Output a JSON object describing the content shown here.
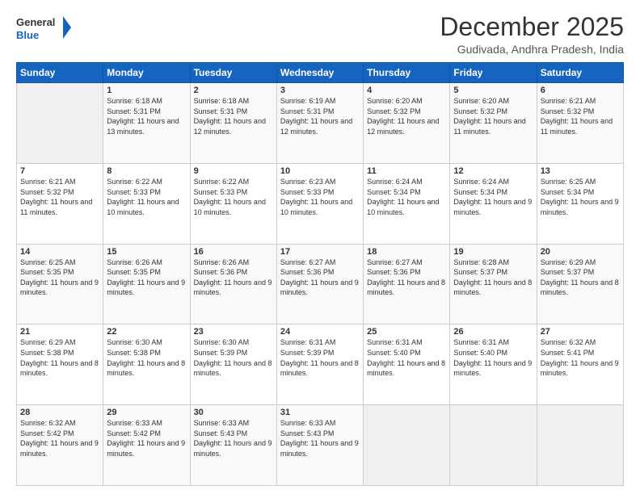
{
  "header": {
    "logo_general": "General",
    "logo_blue": "Blue",
    "month_title": "December 2025",
    "location": "Gudivada, Andhra Pradesh, India"
  },
  "days_of_week": [
    "Sunday",
    "Monday",
    "Tuesday",
    "Wednesday",
    "Thursday",
    "Friday",
    "Saturday"
  ],
  "weeks": [
    [
      {
        "day": "",
        "empty": true
      },
      {
        "day": "1",
        "sunrise": "6:18 AM",
        "sunset": "5:31 PM",
        "daylight": "11 hours and 13 minutes."
      },
      {
        "day": "2",
        "sunrise": "6:18 AM",
        "sunset": "5:31 PM",
        "daylight": "11 hours and 12 minutes."
      },
      {
        "day": "3",
        "sunrise": "6:19 AM",
        "sunset": "5:31 PM",
        "daylight": "11 hours and 12 minutes."
      },
      {
        "day": "4",
        "sunrise": "6:20 AM",
        "sunset": "5:32 PM",
        "daylight": "11 hours and 12 minutes."
      },
      {
        "day": "5",
        "sunrise": "6:20 AM",
        "sunset": "5:32 PM",
        "daylight": "11 hours and 11 minutes."
      },
      {
        "day": "6",
        "sunrise": "6:21 AM",
        "sunset": "5:32 PM",
        "daylight": "11 hours and 11 minutes."
      }
    ],
    [
      {
        "day": "7",
        "sunrise": "6:21 AM",
        "sunset": "5:32 PM",
        "daylight": "11 hours and 11 minutes."
      },
      {
        "day": "8",
        "sunrise": "6:22 AM",
        "sunset": "5:33 PM",
        "daylight": "11 hours and 10 minutes."
      },
      {
        "day": "9",
        "sunrise": "6:22 AM",
        "sunset": "5:33 PM",
        "daylight": "11 hours and 10 minutes."
      },
      {
        "day": "10",
        "sunrise": "6:23 AM",
        "sunset": "5:33 PM",
        "daylight": "11 hours and 10 minutes."
      },
      {
        "day": "11",
        "sunrise": "6:24 AM",
        "sunset": "5:34 PM",
        "daylight": "11 hours and 10 minutes."
      },
      {
        "day": "12",
        "sunrise": "6:24 AM",
        "sunset": "5:34 PM",
        "daylight": "11 hours and 9 minutes."
      },
      {
        "day": "13",
        "sunrise": "6:25 AM",
        "sunset": "5:34 PM",
        "daylight": "11 hours and 9 minutes."
      }
    ],
    [
      {
        "day": "14",
        "sunrise": "6:25 AM",
        "sunset": "5:35 PM",
        "daylight": "11 hours and 9 minutes."
      },
      {
        "day": "15",
        "sunrise": "6:26 AM",
        "sunset": "5:35 PM",
        "daylight": "11 hours and 9 minutes."
      },
      {
        "day": "16",
        "sunrise": "6:26 AM",
        "sunset": "5:36 PM",
        "daylight": "11 hours and 9 minutes."
      },
      {
        "day": "17",
        "sunrise": "6:27 AM",
        "sunset": "5:36 PM",
        "daylight": "11 hours and 9 minutes."
      },
      {
        "day": "18",
        "sunrise": "6:27 AM",
        "sunset": "5:36 PM",
        "daylight": "11 hours and 8 minutes."
      },
      {
        "day": "19",
        "sunrise": "6:28 AM",
        "sunset": "5:37 PM",
        "daylight": "11 hours and 8 minutes."
      },
      {
        "day": "20",
        "sunrise": "6:29 AM",
        "sunset": "5:37 PM",
        "daylight": "11 hours and 8 minutes."
      }
    ],
    [
      {
        "day": "21",
        "sunrise": "6:29 AM",
        "sunset": "5:38 PM",
        "daylight": "11 hours and 8 minutes."
      },
      {
        "day": "22",
        "sunrise": "6:30 AM",
        "sunset": "5:38 PM",
        "daylight": "11 hours and 8 minutes."
      },
      {
        "day": "23",
        "sunrise": "6:30 AM",
        "sunset": "5:39 PM",
        "daylight": "11 hours and 8 minutes."
      },
      {
        "day": "24",
        "sunrise": "6:31 AM",
        "sunset": "5:39 PM",
        "daylight": "11 hours and 8 minutes."
      },
      {
        "day": "25",
        "sunrise": "6:31 AM",
        "sunset": "5:40 PM",
        "daylight": "11 hours and 8 minutes."
      },
      {
        "day": "26",
        "sunrise": "6:31 AM",
        "sunset": "5:40 PM",
        "daylight": "11 hours and 9 minutes."
      },
      {
        "day": "27",
        "sunrise": "6:32 AM",
        "sunset": "5:41 PM",
        "daylight": "11 hours and 9 minutes."
      }
    ],
    [
      {
        "day": "28",
        "sunrise": "6:32 AM",
        "sunset": "5:42 PM",
        "daylight": "11 hours and 9 minutes."
      },
      {
        "day": "29",
        "sunrise": "6:33 AM",
        "sunset": "5:42 PM",
        "daylight": "11 hours and 9 minutes."
      },
      {
        "day": "30",
        "sunrise": "6:33 AM",
        "sunset": "5:43 PM",
        "daylight": "11 hours and 9 minutes."
      },
      {
        "day": "31",
        "sunrise": "6:33 AM",
        "sunset": "5:43 PM",
        "daylight": "11 hours and 9 minutes."
      },
      {
        "day": "",
        "empty": true
      },
      {
        "day": "",
        "empty": true
      },
      {
        "day": "",
        "empty": true
      }
    ]
  ],
  "labels": {
    "sunrise_prefix": "Sunrise: ",
    "sunset_prefix": "Sunset: ",
    "daylight_prefix": "Daylight: "
  }
}
